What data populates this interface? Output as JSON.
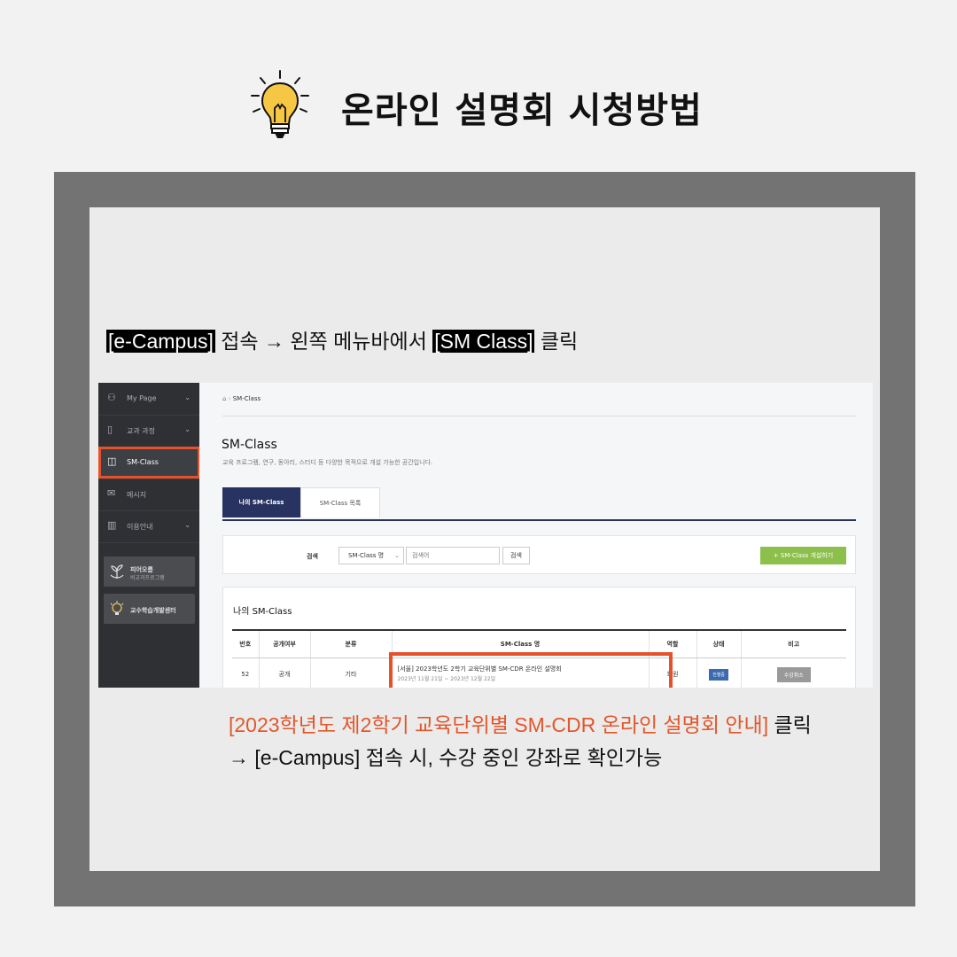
{
  "header": {
    "title": "온라인 설명회 시청방법",
    "icon": "lightbulb-icon"
  },
  "step1": {
    "ecampus": "[e-Campus]",
    "mid": " 접속 → 왼쪽 메뉴바에서 ",
    "smclass": "[SM Class]",
    "end": " 클릭"
  },
  "sidebar": {
    "items": [
      {
        "label": "My Page",
        "icon": "user-icon"
      },
      {
        "label": "교과 과정",
        "icon": "book-icon"
      },
      {
        "label": "SM-Class",
        "icon": "open-book-icon"
      },
      {
        "label": "메시지",
        "icon": "mail-icon"
      },
      {
        "label": "이용안내",
        "icon": "map-icon"
      }
    ],
    "banners": [
      {
        "title": "피어오름",
        "subtitle": "비교과프로그램"
      },
      {
        "title": "교수학습개발센터",
        "subtitle": ""
      }
    ]
  },
  "main": {
    "breadcrumb": "SM-Class",
    "heading": "SM-Class",
    "description": "교육 프로그램, 연구, 동아리, 스터디 등 다양한 목적으로 개설 가능한 공간입니다.",
    "tabs": [
      "나의 SM-Class",
      "SM-Class 목록"
    ],
    "search": {
      "label": "검색",
      "select": "SM-Class 명",
      "placeholder": "검색어",
      "button": "검색",
      "create": "+ SM-Class 개설하기"
    },
    "list": {
      "title": "나의 SM-Class",
      "columns": [
        "번호",
        "공개여부",
        "분류",
        "SM-Class 명",
        "역할",
        "상태",
        "비고"
      ],
      "rows": [
        {
          "no": "52",
          "public": "공개",
          "category": "기타",
          "name": "[서울] 2023학년도 2학기 교육단위별 SM-CDR 온라인 설명회",
          "date": "2023년 11월 21일 ~ 2023년 12월 22일",
          "role": "회원",
          "status": "진행중",
          "note": "수강취소"
        }
      ]
    }
  },
  "step2": {
    "line1_highlight": "[2023학년도 제2학기 교육단위별 SM-CDR 온라인 설명회 안내]",
    "line1_end": " 클릭",
    "line2": "→ [e-Campus] 접속 시, 수강 중인 강좌로 확인가능"
  },
  "colors": {
    "accent": "#e5512b",
    "navy": "#283362",
    "green": "#8cbf4c",
    "frame": "#737373"
  }
}
